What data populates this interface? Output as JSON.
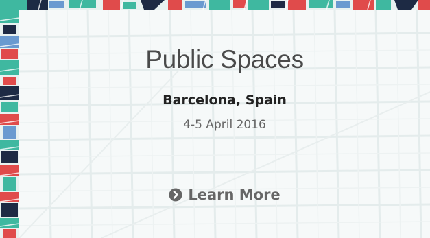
{
  "event": {
    "title": "Public Spaces",
    "location": "Barcelona, Spain",
    "dates": "4-5 April 2016",
    "cta_label": "Learn More",
    "cta_icon": "chevron-circle-right-icon"
  },
  "colors": {
    "panel_bg": "#f7f9fa",
    "title_text": "#4a4a4a",
    "location_text": "#222222",
    "dates_text": "#666666",
    "cta_text": "#666666",
    "border_teal": "#3fb8a0",
    "border_red": "#e04b4b",
    "border_navy": "#1d2a44",
    "border_blue": "#6a9ad0"
  }
}
